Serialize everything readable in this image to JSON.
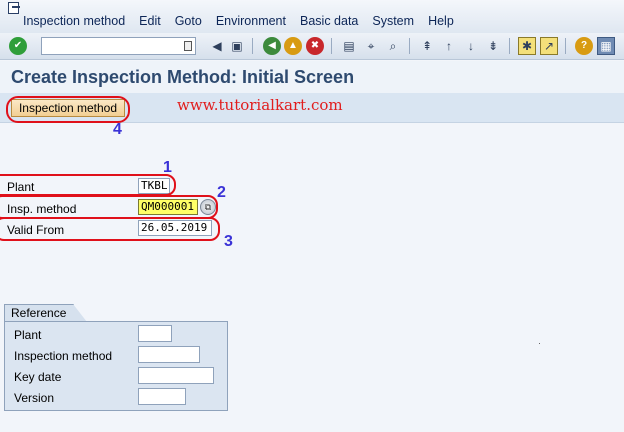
{
  "menu": {
    "items": [
      "Inspection method",
      "Edit",
      "Goto",
      "Environment",
      "Basic data",
      "System",
      "Help"
    ]
  },
  "toolbar": {
    "command_field_value": "",
    "icons": [
      "enter-icon",
      "back-nav-icon",
      "save-icon",
      "back-icon",
      "exit-icon",
      "cancel-icon",
      "print-icon",
      "find-icon",
      "find-next-icon",
      "first-page-icon",
      "prev-page-icon",
      "next-page-icon",
      "last-page-icon",
      "create-session-icon",
      "shortcut-icon",
      "help-icon",
      "customize-layout-icon"
    ]
  },
  "title": "Create Inspection Method: Initial Screen",
  "app_toolbar": {
    "button_label": "Inspection method",
    "watermark": "www.tutorialkart.com"
  },
  "steps": [
    "1",
    "2",
    "3",
    "4"
  ],
  "form": {
    "plant_label": "Plant",
    "plant_value": "TKBL",
    "insp_method_label": "Insp. method",
    "insp_method_value": "QM000001",
    "valid_from_label": "Valid From",
    "valid_from_value": "26.05.2019"
  },
  "reference": {
    "tab_label": "Reference",
    "plant_label": "Plant",
    "plant_value": "",
    "method_label": "Inspection method",
    "method_value": "",
    "key_date_label": "Key date",
    "key_date_value": "",
    "version_label": "Version",
    "version_value": ""
  },
  "colors": {
    "highlight": "#e0101a",
    "step_number": "#3a32d6",
    "title": "#2e4a6f",
    "watermark": "#e11d1d"
  }
}
